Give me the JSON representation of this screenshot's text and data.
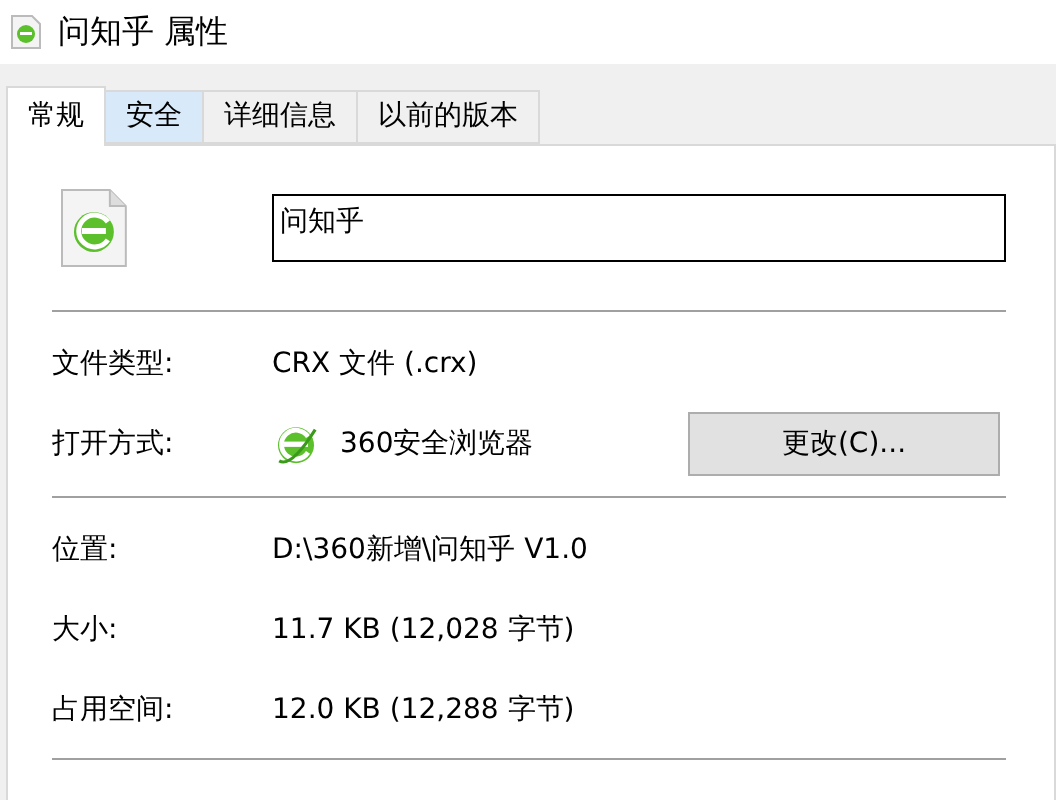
{
  "window": {
    "title": "问知乎 属性"
  },
  "tabs": [
    {
      "label": "常规",
      "selected": true,
      "hovered": false
    },
    {
      "label": "安全",
      "selected": false,
      "hovered": true
    },
    {
      "label": "详细信息",
      "selected": false,
      "hovered": false
    },
    {
      "label": "以前的版本",
      "selected": false,
      "hovered": false
    }
  ],
  "name_field": {
    "value": "问知乎"
  },
  "groups": [
    [
      {
        "label": "文件类型:",
        "value": "CRX 文件 (.crx)"
      },
      {
        "kind": "opens_with",
        "label": "打开方式:",
        "value": "360安全浏览器",
        "button": "更改(C)..."
      }
    ],
    [
      {
        "label": "位置:",
        "value": "D:\\360新增\\问知乎 V1.0"
      },
      {
        "label": "大小:",
        "value": "11.7 KB (12,028 字节)"
      },
      {
        "label": "占用空间:",
        "value": "12.0 KB (12,288 字节)"
      }
    ]
  ]
}
